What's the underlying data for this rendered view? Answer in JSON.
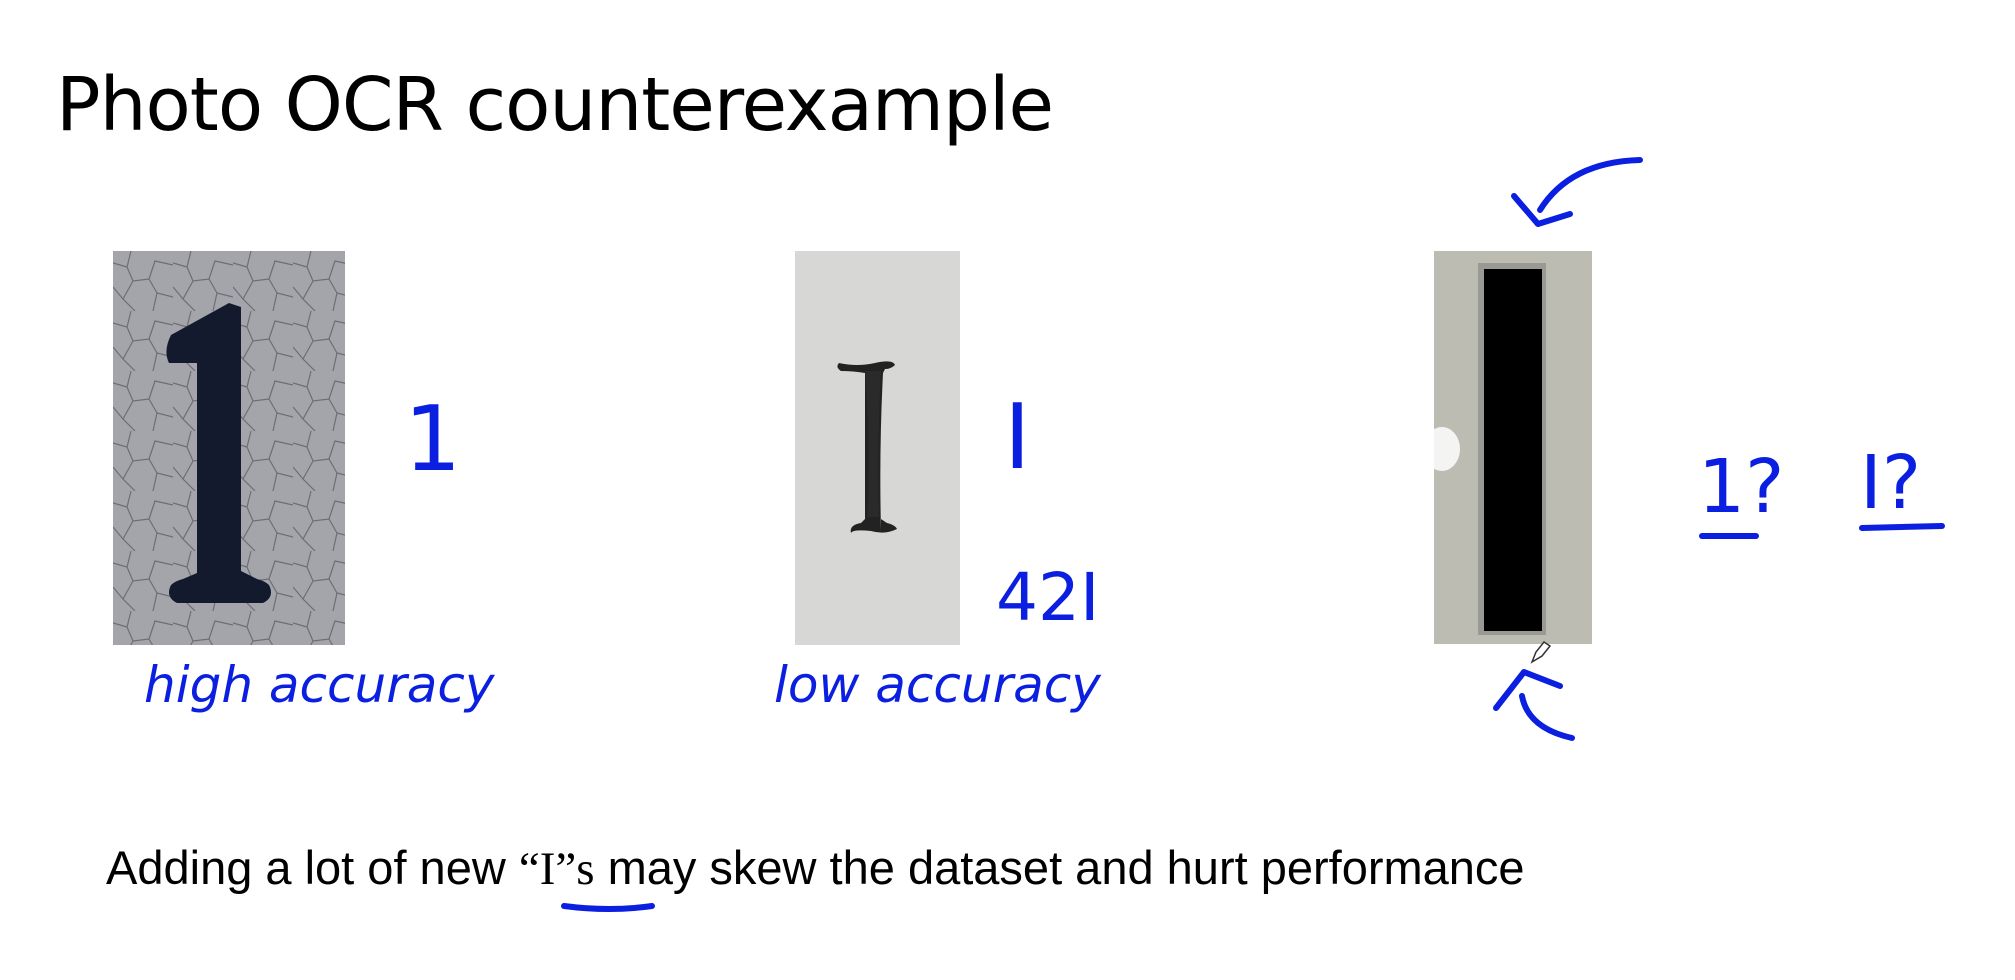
{
  "slide": {
    "title": "Photo OCR counterexample",
    "footer": {
      "before": "Adding a lot of new ",
      "quoted": "“I”s",
      "after": " may skew the dataset and hurt performance"
    }
  },
  "examples": [
    {
      "glyph": "1",
      "note": "high accuracy"
    },
    {
      "glyph": "I",
      "note": "low accuracy",
      "extra": "42I"
    },
    {
      "glyph_options": [
        "1?",
        "I?"
      ]
    }
  ],
  "colors": {
    "ink": "#0b1fe0",
    "text": "#000000"
  }
}
